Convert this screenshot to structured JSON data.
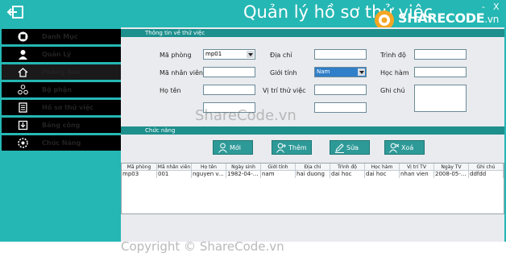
{
  "header": {
    "title": "Quản lý hồ sơ thử việc",
    "minimize": "-",
    "close": "X",
    "logo": {
      "main": "SHARECODE",
      "suffix": ".vn"
    }
  },
  "sidebar": {
    "items": [
      {
        "label": "Danh Mục",
        "icon": "list-icon"
      },
      {
        "label": "Quản Lý",
        "icon": "user-icon"
      },
      {
        "label": "Phòng ban",
        "icon": "home-icon"
      },
      {
        "label": "Bộ phận",
        "icon": "network-icon"
      },
      {
        "label": "Hồ sơ thử việc",
        "icon": "document-icon"
      },
      {
        "label": "Bảng công",
        "icon": "download-icon"
      },
      {
        "label": "Chức Năng",
        "icon": "gear-icon"
      }
    ]
  },
  "info": {
    "heading": "Thông tin về thử việc",
    "ma_phong_label": "Mã phòng",
    "ma_phong_value": "mp01",
    "dia_chi_label": "Địa chỉ",
    "trinh_do_label": "Trình độ",
    "ma_nv_label": "Mã nhân viên",
    "gioi_tinh_label": "Giới tính",
    "gioi_tinh_value": "Nam",
    "hoc_ham_label": "Học hàm",
    "ho_ten_label": "Họ tên",
    "vi_tri_label": "Vị trí thử việc",
    "ghi_chu_label": "Ghi chú"
  },
  "actions": {
    "heading": "Chức năng",
    "new": "Mới",
    "add": "Thêm",
    "edit": "Sửa",
    "delete": "Xoá"
  },
  "table": {
    "columns": [
      "Mã phòng",
      "Mã nhân viên",
      "Họ tên",
      "Ngày sinh",
      "Giới tính",
      "Địa chỉ",
      "Trình độ",
      "Học hàm",
      "Vị trí TV",
      "Ngày TV",
      "Ghi chú"
    ],
    "rows": [
      [
        "mp03",
        "001",
        "nguyen v...",
        "1982-04-...",
        "nam",
        "hai duong",
        "dai hoc",
        "dai hoc",
        "nhan vien",
        "2008-05-...",
        "ddfdd"
      ]
    ]
  },
  "watermark": "ShareCode.vn",
  "footer": "Copyright © ShareCode.vn",
  "colors": {
    "teal": "#25b7b4",
    "section": "#1d8f8d",
    "nav": "#000000"
  }
}
